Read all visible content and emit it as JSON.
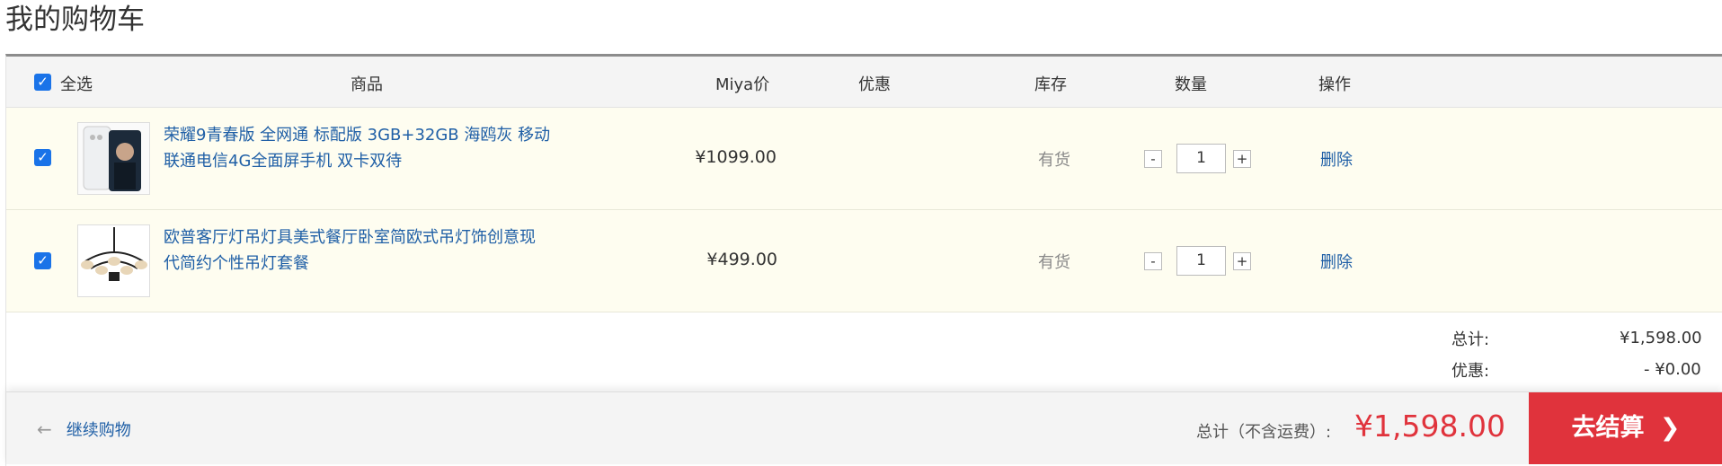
{
  "page_title": "我的购物车",
  "header": {
    "select_all": "全选",
    "col_product": "商品",
    "col_price": "Miya价",
    "col_discount": "优惠",
    "col_stock": "库存",
    "col_qty": "数量",
    "col_action": "操作"
  },
  "items": [
    {
      "name_line1": "荣耀9青春版 全网通 标配版 3GB+32GB 海鸥灰 移动",
      "name_line2": "联通电信4G全面屏手机 双卡双待",
      "price": "¥1099.00",
      "stock": "有货",
      "qty": "1",
      "delete": "删除",
      "checked": true
    },
    {
      "name_line1": "欧普客厅灯吊灯具美式餐厅卧室简欧式吊灯饰创意现",
      "name_line2": "代简约个性吊灯套餐",
      "price": "¥499.00",
      "stock": "有货",
      "qty": "1",
      "delete": "删除",
      "checked": true
    }
  ],
  "qty_controls": {
    "minus": "-",
    "plus": "+"
  },
  "summary": {
    "total_label": "总计:",
    "total_value": "¥1,598.00",
    "discount_label": "优惠:",
    "discount_value": "- ¥0.00"
  },
  "footer": {
    "continue_shopping": "继续购物",
    "grand_total_label": "总计（不含运费）:",
    "grand_total": "¥1,598.00",
    "checkout_label": "去结算"
  },
  "colors": {
    "accent_red": "#e0333c",
    "link_blue": "#1f5fa6",
    "row_bg": "#fefdf0",
    "checkbox_blue": "#1a73e8"
  }
}
